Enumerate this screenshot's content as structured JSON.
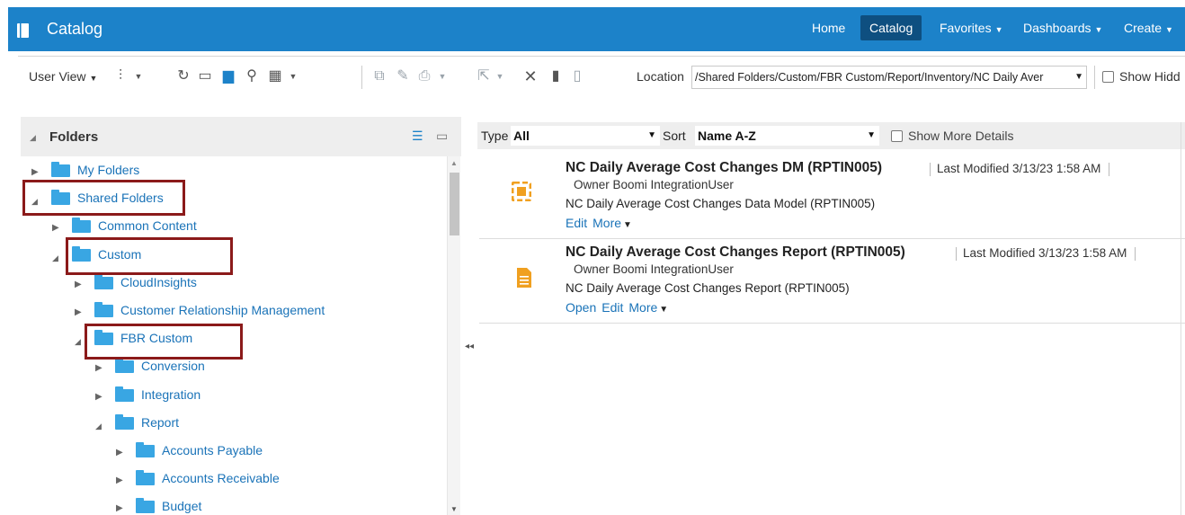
{
  "header": {
    "app_title": "Catalog",
    "nav": {
      "home": "Home",
      "catalog": "Catalog",
      "favorites": "Favorites",
      "dashboards": "Dashboards",
      "create": "Create"
    },
    "colors": {
      "bar": "#1c82c9",
      "active": "#0e4f80"
    }
  },
  "toolbar": {
    "user_view": "User View",
    "location_label": "Location",
    "location_value": "/Shared Folders/Custom/FBR Custom/Report/Inventory/NC Daily Aver",
    "show_hidden": "Show Hidd",
    "icons": [
      "tree-view-icon",
      "refresh-icon",
      "new-folder-icon",
      "upload-icon",
      "search-icon",
      "table-view-icon",
      "copy-icon",
      "edit-icon",
      "print-icon",
      "share-icon",
      "delete-icon",
      "copy-doc-icon",
      "paste-icon"
    ]
  },
  "folders": {
    "title": "Folders",
    "tree": [
      {
        "label": "My Folders",
        "expanded": false,
        "level": 0
      },
      {
        "label": "Shared Folders",
        "expanded": true,
        "level": 0,
        "highlighted": true
      },
      {
        "label": "Common Content",
        "expanded": false,
        "level": 1
      },
      {
        "label": "Custom",
        "expanded": true,
        "level": 1,
        "highlighted": true
      },
      {
        "label": "CloudInsights",
        "expanded": false,
        "level": 2
      },
      {
        "label": "Customer Relationship Management",
        "expanded": false,
        "level": 2
      },
      {
        "label": "FBR Custom",
        "expanded": true,
        "level": 2,
        "highlighted": true
      },
      {
        "label": "Conversion",
        "expanded": false,
        "level": 3
      },
      {
        "label": "Integration",
        "expanded": false,
        "level": 3
      },
      {
        "label": "Report",
        "expanded": true,
        "level": 3
      },
      {
        "label": "Accounts Payable",
        "expanded": false,
        "level": 4
      },
      {
        "label": "Accounts Receivable",
        "expanded": false,
        "level": 4
      },
      {
        "label": "Budget",
        "expanded": false,
        "level": 4
      }
    ]
  },
  "filters": {
    "type_label": "Type",
    "type_value": "All",
    "sort_label": "Sort",
    "sort_value": "Name A-Z",
    "show_more_details": "Show More Details"
  },
  "items": [
    {
      "title": "NC Daily Average Cost Changes DM (RPTIN005)",
      "modified": "Last Modified 3/13/23 1:58 AM",
      "owner": "Owner Boomi IntegrationUser",
      "description": "NC Daily Average Cost Changes Data Model (RPTIN005)",
      "actions": [
        "Edit",
        "More"
      ],
      "icon": "data-model-icon"
    },
    {
      "title": "NC Daily Average Cost Changes Report (RPTIN005)",
      "modified": "Last Modified 3/13/23 1:58 AM",
      "owner": "Owner Boomi IntegrationUser",
      "description": "NC Daily Average Cost Changes Report (RPTIN005)",
      "actions": [
        "Open",
        "Edit",
        "More"
      ],
      "icon": "report-icon"
    }
  ],
  "highlight_color": "#8b1a1a"
}
